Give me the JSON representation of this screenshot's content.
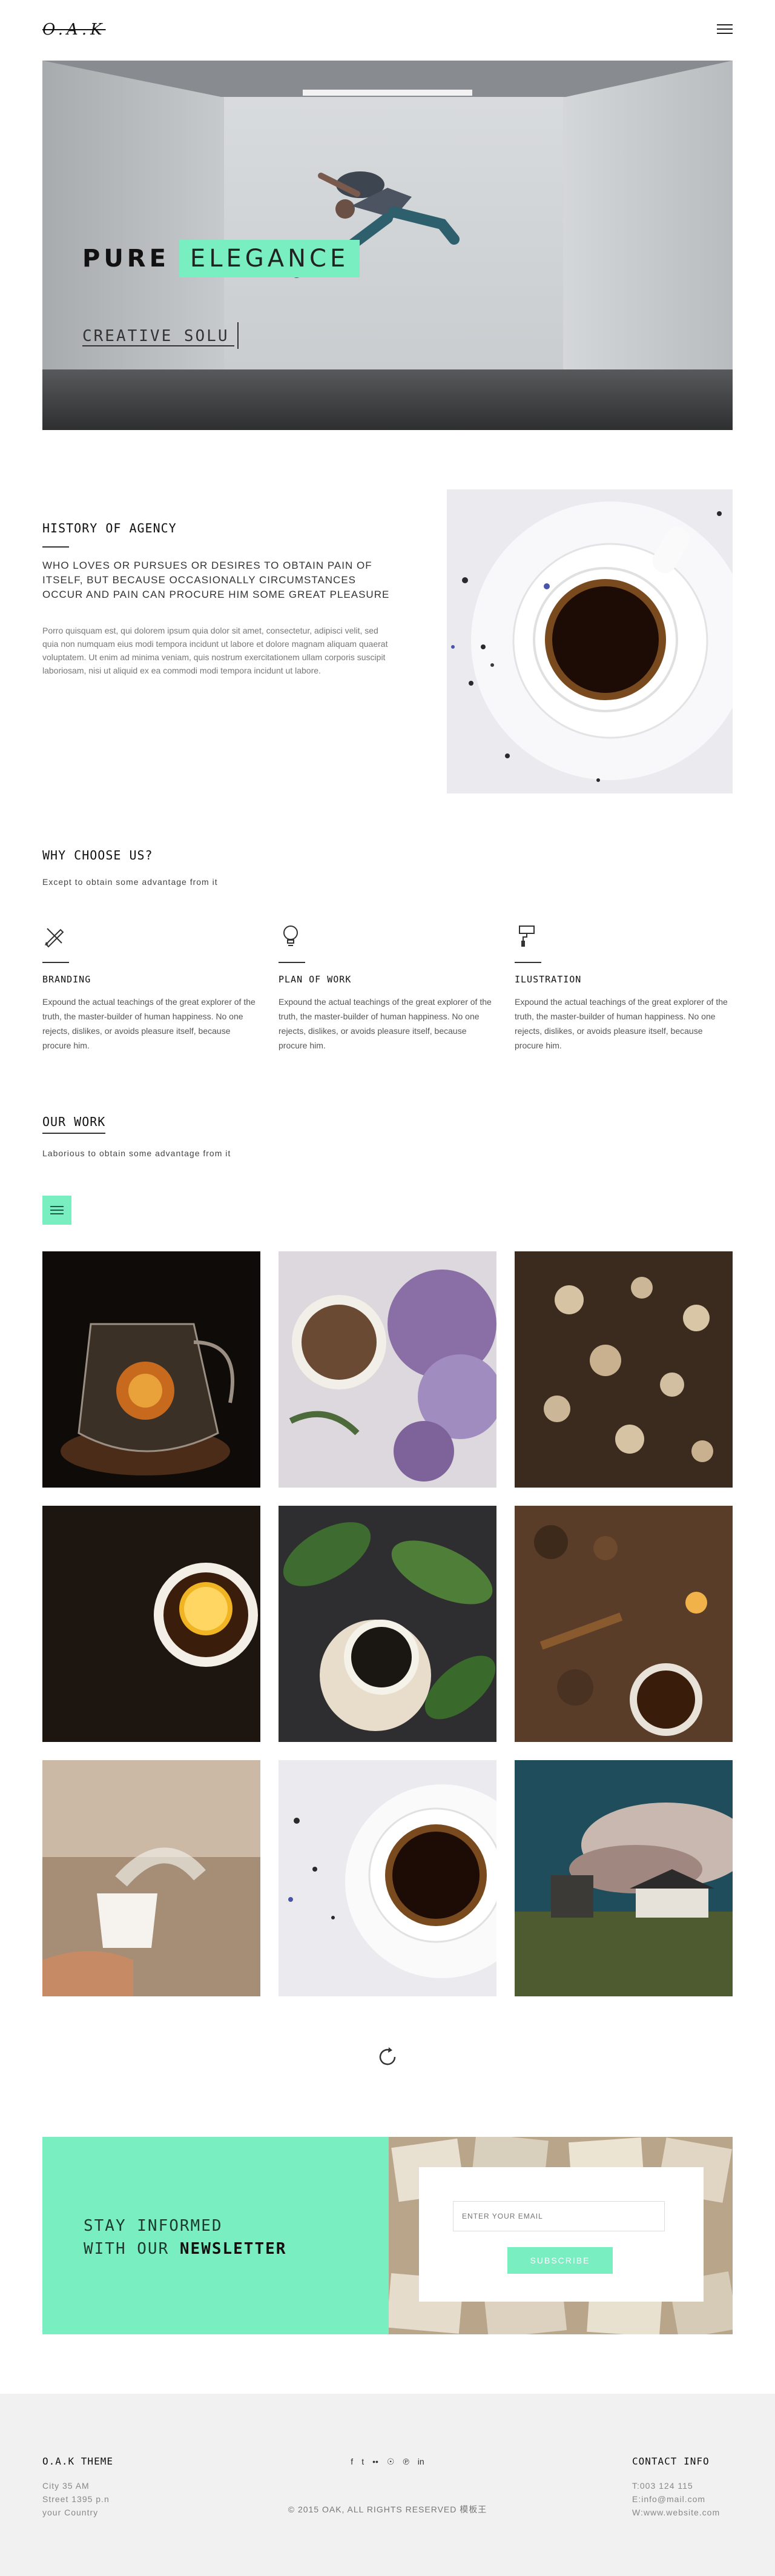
{
  "header": {
    "logo": "O.A.K",
    "menu_icon": "hamburger-icon"
  },
  "hero": {
    "title_bold": "PURE",
    "title_highlight": "ELEGANCE",
    "subtitle": "CREATIVE SOLU"
  },
  "history": {
    "title": "HISTORY OF AGENCY",
    "lead": "WHO LOVES OR PURSUES OR DESIRES TO OBTAIN PAIN OF ITSELF, BUT BECAUSE OCCASIONALLY CIRCUMSTANCES OCCUR AND PAIN CAN PROCURE HIM SOME GREAT PLEASURE",
    "body": "Porro quisquam est, qui dolorem ipsum quia dolor sit amet, consectetur, adipisci velit, sed quia non numquam eius modi tempora incidunt ut labore et dolore magnam aliquam quaerat voluptatem. Ut enim ad minima veniam, quis nostrum exercitationem ullam corporis suscipit laboriosam, nisi ut aliquid ex ea commodi modi tempora incidunt ut labore."
  },
  "why": {
    "title": "WHY CHOOSE US?",
    "description": "Except to obtain some advantage from it",
    "features": [
      {
        "icon": "pencil-ruler-icon",
        "name": "BRANDING",
        "text": "Expound the actual teachings of the great explorer of the truth, the master-builder of human happiness. No one rejects, dislikes, or avoids pleasure itself, because procure him."
      },
      {
        "icon": "lightbulb-icon",
        "name": "PLAN OF WORK",
        "text": "Expound the actual teachings of the great explorer of the truth, the master-builder of human happiness. No one rejects, dislikes, or avoids pleasure itself, because procure him."
      },
      {
        "icon": "paint-roller-icon",
        "name": "ILUSTRATION",
        "text": "Expound the actual teachings of the great explorer of the truth, the master-builder of human happiness. No one rejects, dislikes, or avoids pleasure itself, because procure him."
      }
    ]
  },
  "work": {
    "title": "OUR WORK",
    "description": "Laborious to obtain some advantage from it",
    "filter_icon": "list-icon",
    "items": [
      "glass-teapot",
      "lilac-tea",
      "dried-flowers",
      "lemon-tea",
      "green-leaves-tea",
      "cinnamon-tea",
      "hand-holding-cup",
      "tea-cup-white",
      "castle-landscape"
    ]
  },
  "load_more_icon": "refresh-icon",
  "newsletter": {
    "line1": "STAY INFORMED",
    "line2_prefix": "WITH OUR ",
    "line2_bold": "NEWSLETTER",
    "email_placeholder": "ENTER YOUR EMAIL",
    "submit_label": "SUBSCRIBE"
  },
  "footer": {
    "left_title": "O.A.K THEME",
    "address": [
      "City 35 AM",
      "Street 1395 p.n",
      "your Country"
    ],
    "socials": [
      "f",
      "t",
      "••",
      "☉",
      "℗",
      "in"
    ],
    "copyright": "© 2015 OAK, ALL RIGHTS RESERVED 模板王",
    "right_title": "CONTACT INFO",
    "contacts": [
      "T:003 124 115",
      "E:info@mail.com",
      "W:www.website.com"
    ]
  },
  "colors": {
    "accent": "#79eec0",
    "text": "#222222",
    "footer_bg": "#f1f1f1"
  }
}
